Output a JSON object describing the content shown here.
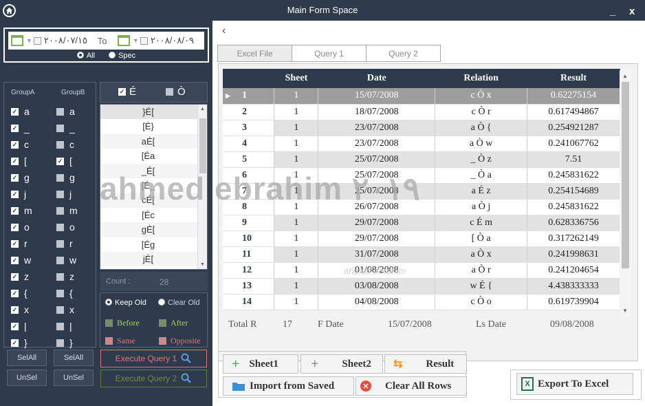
{
  "titlebar": {
    "title": "Main Form Space",
    "minimize": "_",
    "close": "x"
  },
  "date_filter": {
    "from": "٢٠٠٨/٠٧/١٥",
    "to_label": "To",
    "to": "٢٠٠٨/٠٨/٠٩",
    "all_label": "All",
    "spec_label": "Spec"
  },
  "groups": {
    "a_header": "GroupA",
    "b_header": "GroupB",
    "a_items": [
      {
        "label": "a",
        "checked": true
      },
      {
        "label": "_",
        "checked": true
      },
      {
        "label": "c",
        "checked": true
      },
      {
        "label": "[",
        "checked": true
      },
      {
        "label": "g",
        "checked": true
      },
      {
        "label": "j",
        "checked": true
      },
      {
        "label": "m",
        "checked": true
      },
      {
        "label": "o",
        "checked": true
      },
      {
        "label": "r",
        "checked": true
      },
      {
        "label": "w",
        "checked": true
      },
      {
        "label": "z",
        "checked": true
      },
      {
        "label": "{",
        "checked": true
      },
      {
        "label": "x",
        "checked": true
      },
      {
        "label": "|",
        "checked": true
      },
      {
        "label": "}",
        "checked": true
      }
    ],
    "b_items": [
      {
        "label": "a",
        "checked": false
      },
      {
        "label": "_",
        "checked": false
      },
      {
        "label": "c",
        "checked": false
      },
      {
        "label": "[",
        "checked": true
      },
      {
        "label": "g",
        "checked": false
      },
      {
        "label": "j",
        "checked": false
      },
      {
        "label": "m",
        "checked": false
      },
      {
        "label": "o",
        "checked": false
      },
      {
        "label": "r",
        "checked": false
      },
      {
        "label": "w",
        "checked": false
      },
      {
        "label": "z",
        "checked": false
      },
      {
        "label": "{",
        "checked": false
      },
      {
        "label": "x",
        "checked": false
      },
      {
        "label": "|",
        "checked": false
      },
      {
        "label": "}",
        "checked": false
      }
    ],
    "sel_all": "SelAll",
    "unsel": "UnSel"
  },
  "middle": {
    "head_a": "É",
    "head_b": "Ò",
    "items": [
      "}É[",
      "[É}",
      "aÉ[",
      "[Éa",
      "_É[",
      "[É_",
      "cÉ[",
      "[Éc",
      "gÉ[",
      "[Ég",
      "jÉ["
    ],
    "count_label": "Count :",
    "count_value": "28",
    "keep_old": "Keep Old",
    "clear_old": "Clear Old",
    "before": "Before",
    "after": "After",
    "same": "Same",
    "opposite": "Opposite",
    "exec1": "Execute Query 1",
    "exec2": "Execute Query 2"
  },
  "tabs": [
    "Excel File",
    "Query 1",
    "Query 2"
  ],
  "grid": {
    "columns": [
      "",
      "Sheet",
      "Date",
      "Relation",
      "Result"
    ],
    "rows": [
      [
        "1",
        "1",
        "15/07/2008",
        "c Ò x",
        "0.62275154"
      ],
      [
        "2",
        "1",
        "18/07/2008",
        "c Ò r",
        "0.617494867"
      ],
      [
        "3",
        "1",
        "23/07/2008",
        "a Ò {",
        "0.254921287"
      ],
      [
        "4",
        "1",
        "23/07/2008",
        "a Ò w",
        "0.241067762"
      ],
      [
        "5",
        "1",
        "25/07/2008",
        "_ Ò z",
        "7.51"
      ],
      [
        "6",
        "1",
        "25/07/2008",
        "_ Ò a",
        "0.245831622"
      ],
      [
        "7",
        "1",
        "25/07/2008",
        "a É z",
        "0.254154689"
      ],
      [
        "8",
        "1",
        "26/07/2008",
        "a Ò j",
        "0.245831622"
      ],
      [
        "9",
        "1",
        "29/07/2008",
        "c É m",
        "0.628336756"
      ],
      [
        "10",
        "1",
        "29/07/2008",
        "[ Ò a",
        "0.317262149"
      ],
      [
        "11",
        "1",
        "31/07/2008",
        "a Ò x",
        "0.241998631"
      ],
      [
        "12",
        "1",
        "01/08/2008",
        "a Ò r",
        "0.241204654"
      ],
      [
        "13",
        "1",
        "03/08/2008",
        "w É {",
        "4.438333333"
      ],
      [
        "14",
        "1",
        "04/08/2008",
        "c Ò o",
        "0.619739904"
      ]
    ]
  },
  "summary": {
    "total_label": "Total R",
    "total_value": "17",
    "fdate_label": "F Date",
    "fdate_value": "15/07/2008",
    "lsdate_label": "Ls Date",
    "lsdate_value": "09/08/2008"
  },
  "actions": {
    "sheet1": "Sheet1",
    "sheet2": "Sheet2",
    "result": "Result",
    "import": "Import from Saved",
    "clear": "Clear All Rows",
    "export": "Export To Excel"
  },
  "watermark": "ahmed ebrahim ٢٠١٩",
  "watermark_small": "ahmed ebrahim",
  "colors": {
    "bg": "#2e3b4d",
    "accent_green": "#7cb342",
    "exec1": "#e57373",
    "exec2": "#7a8a3a",
    "same": "#e57373",
    "before": "#a5d36b"
  }
}
